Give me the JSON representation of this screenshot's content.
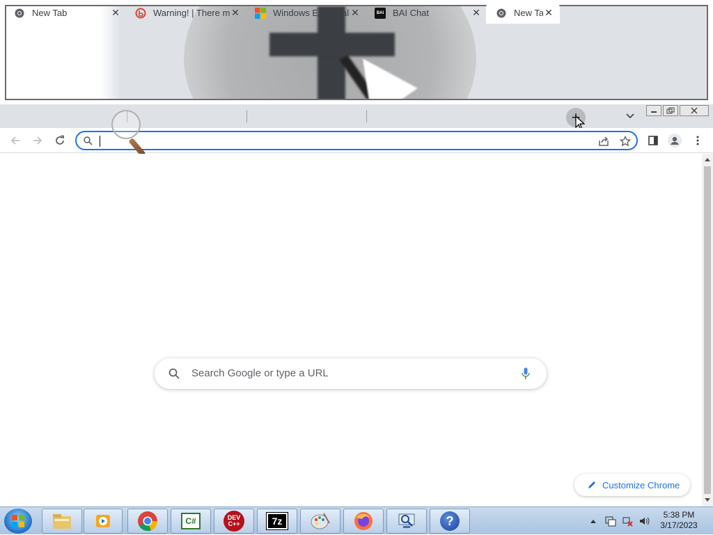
{
  "tabs": [
    {
      "title": "New Tab",
      "favicon": "chrome-icon",
      "active": false
    },
    {
      "title": "Warning! | There mi",
      "favicon": "warning-site-icon",
      "active": false
    },
    {
      "title": "Windows Essentials",
      "favicon": "microsoft-logo-icon",
      "active": false
    },
    {
      "title": "BAI Chat",
      "favicon": "bai-icon",
      "active": false
    },
    {
      "title": "New Ta",
      "favicon": "chrome-icon",
      "active": true
    }
  ],
  "bai_favicon_text": "BAI",
  "new_tab_button": "+",
  "omnibox": {
    "value": "",
    "placeholder": ""
  },
  "ntp": {
    "search_placeholder": "Search Google or type a URL",
    "customize_label": "Customize Chrome"
  },
  "taskbar": {
    "apps": [
      "explorer",
      "media-player",
      "chrome",
      "csharp",
      "dev-cpp",
      "7zip",
      "paint",
      "firefox",
      "network-tool",
      "help"
    ],
    "csharp_label": "C#",
    "devcpp_label": "DEV C++",
    "sevenzip_label": "7z",
    "help_label": "?",
    "time": "5:38 PM",
    "date": "3/17/2023"
  },
  "colors": {
    "accent": "#1a73e8",
    "tabstrip": "#dee1e6"
  }
}
